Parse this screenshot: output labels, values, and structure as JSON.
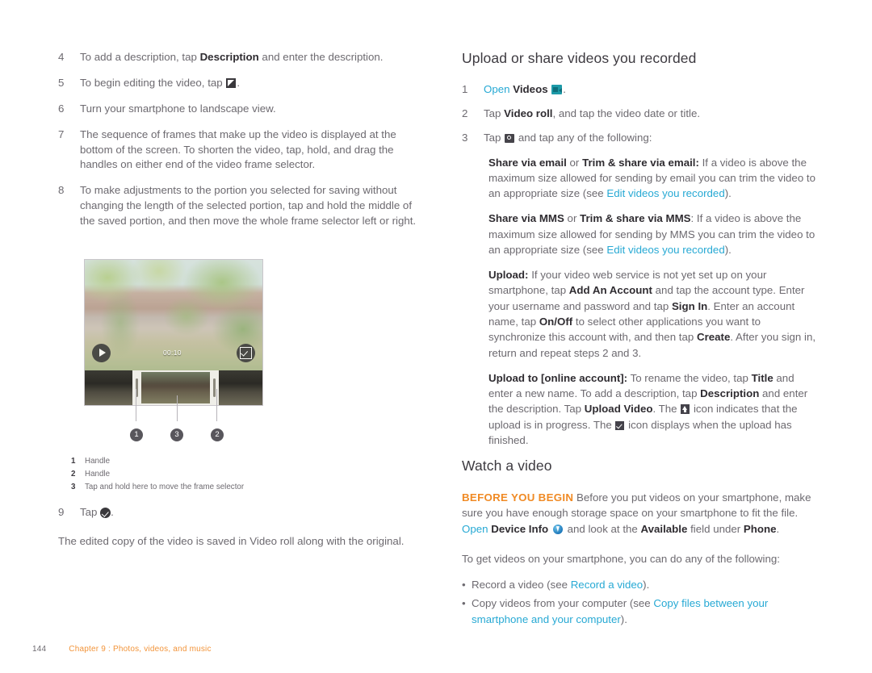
{
  "left_column": {
    "steps": [
      {
        "num": "4",
        "pre": "To add a description, tap ",
        "bold1": "Description",
        "post": " and enter the description."
      },
      {
        "num": "5",
        "pre": "To begin editing the video, tap ",
        "icon": "edit-icon",
        "post": "."
      },
      {
        "num": "6",
        "pre": "Turn your smartphone to landscape view.",
        "post": ""
      },
      {
        "num": "7",
        "pre": "The sequence of frames that make up the video is displayed at the bottom of the screen. To shorten the video, tap, hold, and drag the handles on either end of the video frame selector.",
        "post": ""
      },
      {
        "num": "8",
        "pre": "To make adjustments to the portion you selected for saving without changing the length of the selected portion, tap and hold the middle of the saved portion, and then move the whole frame selector left or right.",
        "post": ""
      }
    ],
    "figure": {
      "timecode": "00:10",
      "play_label": "play-button",
      "confirm_label": "confirm-button",
      "callouts": [
        "1",
        "3",
        "2"
      ]
    },
    "legend": [
      {
        "num": "1",
        "text": "Handle"
      },
      {
        "num": "2",
        "text": "Handle"
      },
      {
        "num": "3",
        "text": "Tap and hold here to move the frame selector"
      }
    ],
    "final_step": {
      "num": "9",
      "pre": "Tap ",
      "post": "."
    },
    "closing_note": "The edited copy of the video is saved in Video roll along with the original."
  },
  "right_column": {
    "heading_upload": "Upload or share videos you recorded",
    "steps": [
      {
        "num": "1",
        "link": "Open",
        "bold": "Videos",
        "post": "."
      },
      {
        "num": "2",
        "pre": "Tap ",
        "bold": "Video roll",
        "post": ", and tap the video date or title."
      },
      {
        "num": "3",
        "pre": "Tap ",
        "post": " and tap any of the following:"
      }
    ],
    "options": [
      {
        "bold1": "Share via email",
        "mid": " or ",
        "bold2": "Trim & share via email:",
        "text1": " If a video is above the maximum size allowed for sending by email you can trim the video to an appropriate size (see ",
        "link": "Edit videos you recorded",
        "text2": ")."
      },
      {
        "bold1": "Share via MMS",
        "mid": " or ",
        "bold2": "Trim & share via MMS",
        "text1": ": If a video is above the maximum size allowed for sending by MMS you can trim the video to an appropriate size (see ",
        "link": "Edit videos you recorded",
        "text2": ")."
      }
    ],
    "upload_para": {
      "label": "Upload:",
      "t1": " If your video web service is not yet set up on your smartphone, tap ",
      "b1": "Add An Account",
      "t2": " and tap the account type. Enter your username and password and tap ",
      "b2": "Sign In",
      "t3": ". Enter an account name, tap ",
      "b3": "On/Off",
      "t4": " to select other applications you want to synchronize this account with, and then tap ",
      "b4": "Create",
      "t5": ". After you sign in, return and repeat steps 2 and 3."
    },
    "upload_account_para": {
      "label": "Upload to [online account]:",
      "t1": " To rename the video, tap ",
      "b1": "Title",
      "t2": " and enter a new name. To add a description, tap ",
      "b2": "Description",
      "t3": " and enter the description. Tap ",
      "b3": "Upload Video",
      "t4": ". The ",
      "t5": " icon indicates that the upload is in progress. The ",
      "t6": " icon displays when the upload has finished."
    },
    "heading_watch": "Watch a video",
    "before_you_begin": {
      "label": "BEFORE YOU BEGIN",
      "t1": " Before you put videos on your smartphone, make sure you have enough storage space on your smartphone to fit the file. ",
      "link": "Open",
      "b1": " Device Info",
      "t2": " and look at the ",
      "b2": "Available",
      "t3": " field under ",
      "b3": "Phone",
      "t4": "."
    },
    "get_videos_intro": "To get videos on your smartphone, you can do any of the following:",
    "bullets": [
      {
        "pre": "Record a video (see ",
        "link": "Record a video",
        "post": ")."
      },
      {
        "pre": "Copy videos from your computer (see ",
        "link": "Copy files between your smartphone and your computer",
        "post": ")."
      }
    ]
  },
  "footer": {
    "page_number": "144",
    "chapter": "Chapter 9 : Photos, videos, and music"
  },
  "colors": {
    "link": "#27a9d4",
    "accent_orange": "#f2943a",
    "body_text": "#6d6a70",
    "bold_text": "#2f2c31"
  }
}
